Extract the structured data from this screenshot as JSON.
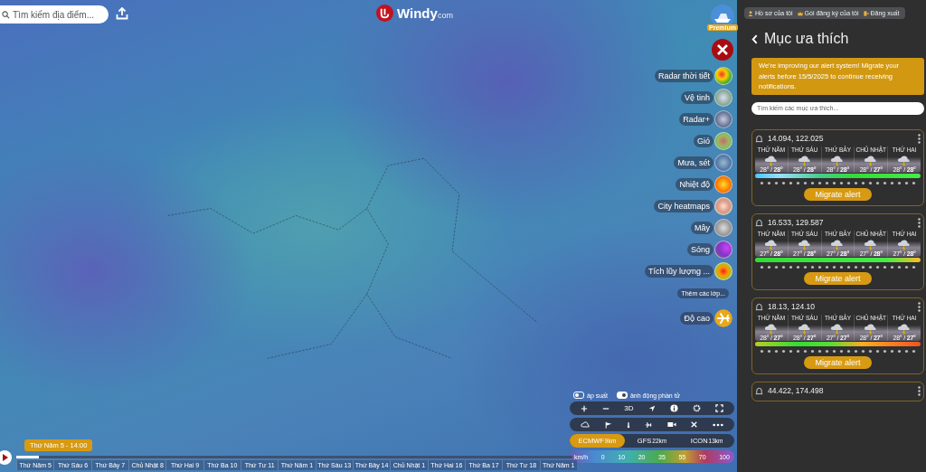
{
  "top_bar": {
    "search": {
      "placeholder": "Tìm kiếm địa điểm..."
    },
    "logo": {
      "text": "Windy",
      "suffix": "com"
    }
  },
  "premium": {
    "label": "Premium"
  },
  "layers": [
    {
      "label": "Radar thời tiết"
    },
    {
      "label": "Vệ tinh"
    },
    {
      "label": "Radar+"
    },
    {
      "label": "Gió"
    },
    {
      "label": "Mưa, sét"
    },
    {
      "label": "Nhiệt độ"
    },
    {
      "label": "City heatmaps"
    },
    {
      "label": "Mây"
    },
    {
      "label": "Sóng"
    },
    {
      "label": "Tích lũy lượng ..."
    }
  ],
  "more_layers": "Thêm các lớp...",
  "altitude": {
    "label": "Độ cao"
  },
  "toggles": [
    {
      "label": "áp suất",
      "on": false
    },
    {
      "label": "ảnh động phần tử",
      "on": true
    }
  ],
  "view_3d": "3D",
  "models": [
    {
      "name": "ECMWF",
      "resolution": "9km",
      "selected": true
    },
    {
      "name": "GFS",
      "resolution": "22km",
      "selected": false
    },
    {
      "name": "ICON",
      "resolution": "13km",
      "selected": false
    }
  ],
  "legend": {
    "unit": "km/h",
    "values": [
      "0",
      "10",
      "20",
      "35",
      "55",
      "70",
      "100"
    ]
  },
  "timeline": {
    "current": "Thứ Năm 5 - 14:00",
    "level": 0.04,
    "days": [
      "Thứ Năm 5",
      "Thứ Sáu 6",
      "Thứ Bảy 7",
      "Chủ Nhật 8",
      "Thứ Hai 9",
      "Thứ Ba 10",
      "Thứ Tư 11",
      "Thứ Năm 1",
      "Thứ Sáu 13",
      "Thứ Bảy 14",
      "Chủ Nhật 1",
      "Thứ Hai 16",
      "Thứ Ba 17",
      "Thứ Tư 18",
      "Thứ Năm 1"
    ]
  },
  "panel": {
    "user_menu": [
      "Hồ sơ của tôi",
      "Gói đăng ký của tôi",
      "Đăng xuất"
    ],
    "title": "Mục ưa thích",
    "notice": "We're improving our alert system! Migrate your alerts before 15/5/2025 to continue receiving notifications.",
    "search": {
      "placeholder": "Tìm kiếm các mục ưa thích..."
    },
    "alerts": [
      {
        "title": "14.094, 122.025",
        "days": [
          {
            "label": "THỨ NĂM",
            "temps": "28° / **28°**"
          },
          {
            "label": "THỨ SÁU",
            "temps": "28° / **28°**"
          },
          {
            "label": "THỨ BẢY",
            "temps": "28° / **28°**"
          },
          {
            "label": "CHỦ NHẬT",
            "temps": "28° / **27°**"
          },
          {
            "label": "THỨ HAI",
            "temps": "28° / **28°**"
          }
        ],
        "button": "Migrate alert"
      },
      {
        "title": "16.533, 129.587",
        "days": [
          {
            "label": "THỨ NĂM",
            "temps": "27° / **28°**"
          },
          {
            "label": "THỨ SÁU",
            "temps": "27° / **28°**"
          },
          {
            "label": "THỨ BẢY",
            "temps": "27° / **28°**"
          },
          {
            "label": "CHỦ NHẬT",
            "temps": "27° / **28°**"
          },
          {
            "label": "THỨ HAI",
            "temps": "27° / **28°**"
          }
        ],
        "button": "Migrate alert"
      },
      {
        "title": "18.13, 124.10",
        "days": [
          {
            "label": "THỨ NĂM",
            "temps": "28° / **27°**"
          },
          {
            "label": "THỨ SÁU",
            "temps": "28° / **27°**"
          },
          {
            "label": "THỨ BẢY",
            "temps": "27° / **27°**"
          },
          {
            "label": "CHỦ NHẬT",
            "temps": "28° / **27°**"
          },
          {
            "label": "THỨ HAI",
            "temps": "28° / **27°**"
          }
        ],
        "button": "Migrate alert"
      },
      {
        "title": "44.422, 174.498"
      }
    ]
  }
}
